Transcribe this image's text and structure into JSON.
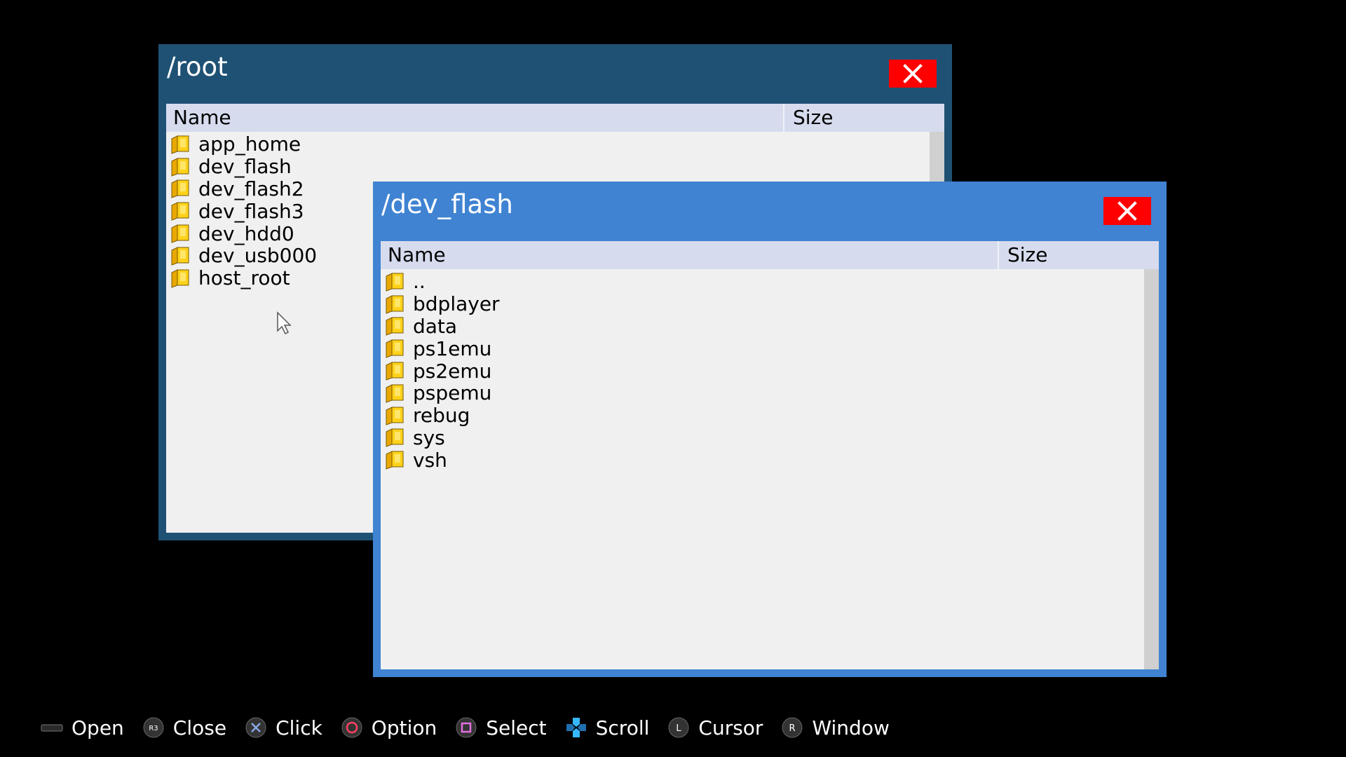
{
  "root_window": {
    "title": "/root",
    "columns": {
      "name": "Name",
      "size": "Size"
    },
    "items": [
      "app_home",
      "dev_flash",
      "dev_flash2",
      "dev_flash3",
      "dev_hdd0",
      "dev_usb000",
      "host_root"
    ]
  },
  "flash_window": {
    "title": "/dev_flash",
    "columns": {
      "name": "Name",
      "size": "Size"
    },
    "items": [
      "..",
      "bdplayer",
      "data",
      "ps1emu",
      "ps2emu",
      "pspemu",
      "rebug",
      "sys",
      "vsh"
    ]
  },
  "footer": {
    "open": "Open",
    "close": "Close",
    "click": "Click",
    "option": "Option",
    "select": "Select",
    "scroll": "Scroll",
    "cursor": "Cursor",
    "window": "Window",
    "close_button_glyph": "R3",
    "cursor_button_glyph": "L",
    "window_button_glyph": "R"
  },
  "colors": {
    "root_window": "#1f5174",
    "flash_window": "#3f83d2",
    "close_button": "#ff0000",
    "list_bg": "#f0f0f0",
    "header_bg": "#d6dcee",
    "folder": "#f5c400"
  }
}
